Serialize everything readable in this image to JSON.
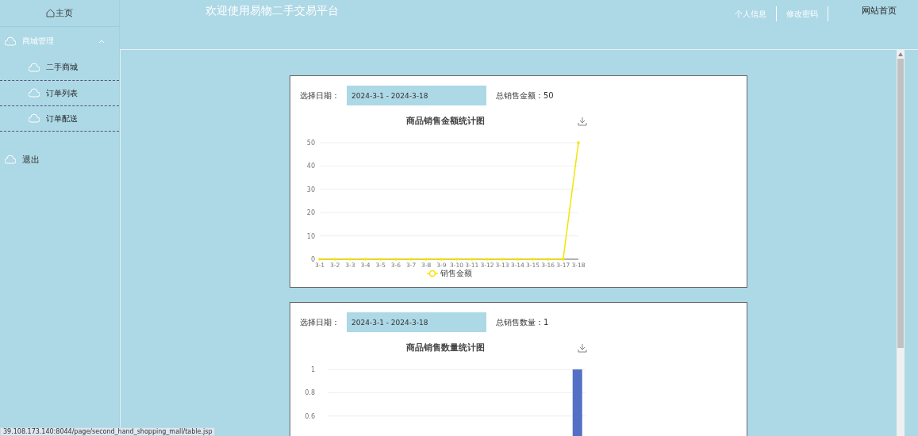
{
  "sidebar": {
    "home": {
      "label": "主页"
    },
    "menu": [
      {
        "label": "商城管理",
        "expanded": true,
        "children": [
          {
            "label": "二手商城"
          },
          {
            "label": "订单列表"
          },
          {
            "label": "订单配送"
          }
        ]
      },
      {
        "label": "退出"
      }
    ]
  },
  "header": {
    "title": "欢迎使用易物二手交易平台",
    "links": [
      "个人信息",
      "修改密码"
    ],
    "home_link": "网站首页"
  },
  "cards": [
    {
      "date_label": "选择日期：",
      "date_value": "2024-3-1 - 2024-3-18",
      "total": "总销售金额：50",
      "chart_data": {
        "type": "line",
        "title": "商品销售金额统计图",
        "categories": [
          "3-1",
          "3-2",
          "3-3",
          "3-4",
          "3-5",
          "3-6",
          "3-7",
          "3-8",
          "3-9",
          "3-10",
          "3-11",
          "3-12",
          "3-13",
          "3-14",
          "3-15",
          "3-16",
          "3-17",
          "3-18"
        ],
        "ylim": [
          0,
          50
        ],
        "yticks": [
          0,
          10,
          20,
          30,
          40,
          50
        ],
        "grid": true,
        "series": [
          {
            "name": "销售金额",
            "color": "#f5e400",
            "values": [
              0,
              0,
              0,
              0,
              0,
              0,
              0,
              0,
              0,
              0,
              0,
              0,
              0,
              0,
              0,
              0,
              0,
              50
            ]
          }
        ]
      }
    },
    {
      "date_label": "选择日期：",
      "date_value": "2024-3-1 - 2024-3-18",
      "total": "总销售数量：1",
      "chart_data": {
        "type": "bar",
        "title": "商品销售数量统计图",
        "ylim": [
          0,
          1
        ],
        "yticks": [
          0.6,
          0.8,
          1
        ],
        "grid": true,
        "series": [
          {
            "color": "#5470c6",
            "values": [
              0,
              0,
              0,
              0,
              0,
              0,
              0,
              0,
              0,
              0,
              0,
              0,
              0,
              0,
              0,
              0,
              0,
              1
            ]
          }
        ]
      }
    }
  ],
  "status_bar": "39.108.173.140:8044/page/second_hand_shopping_mall/table.jsp"
}
